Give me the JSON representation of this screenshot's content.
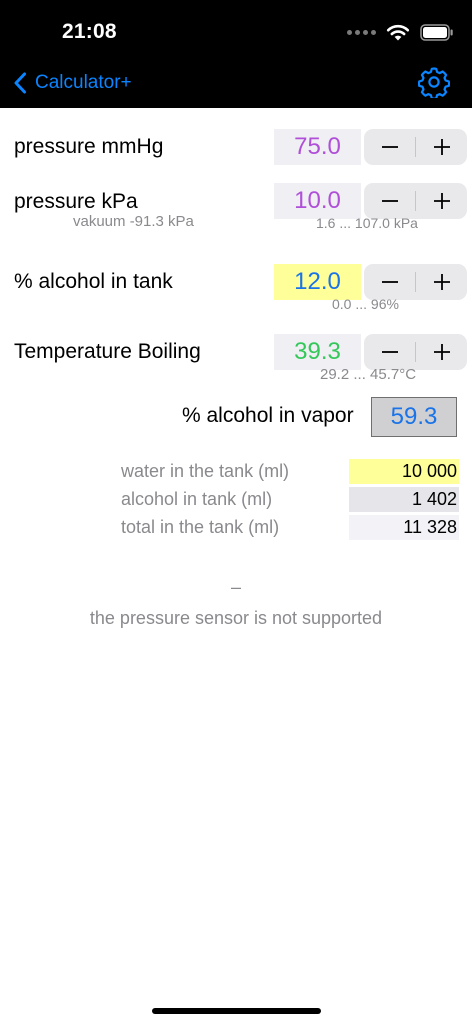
{
  "status": {
    "time": "21:08"
  },
  "nav": {
    "back_label": "Calculator+"
  },
  "rows": [
    {
      "label": "pressure mmHg",
      "value": "75.0"
    },
    {
      "label": "pressure kPa",
      "value": "10.0",
      "note": "vakuum -91.3 kPa",
      "range": "1.6 ... 107.0 kPa"
    },
    {
      "label": "% alcohol in tank",
      "value": "12.0",
      "range": "0.0 ... 96%"
    },
    {
      "label": "Temperature Boiling",
      "value": "39.3",
      "range": "29.2 ... 45.7°C"
    }
  ],
  "vapor": {
    "label": "% alcohol in vapor",
    "value": "59.3"
  },
  "tank": [
    {
      "label": "water in the tank (ml)",
      "value": "10 000"
    },
    {
      "label": "alcohol in tank (ml)",
      "value": "1 402"
    },
    {
      "label": "total in the tank (ml)",
      "value": "11 328"
    }
  ],
  "footer": {
    "dash": "–",
    "message": "the pressure sensor is not supported"
  },
  "colors": {
    "accent": "#0a84ff",
    "pressure_value": "#b04fd8",
    "alcohol_value": "#1a73e8",
    "alcohol_highlight": "#ffff99",
    "temperature_value": "#34c759",
    "water_highlight": "#ffff99",
    "alcohol_tank_bg": "#e5e5ea",
    "total_tank_bg": "#f2f2f7"
  },
  "icons": {
    "back": "chevron-left-icon",
    "settings": "gear-icon",
    "decrement": "minus-icon",
    "increment": "plus-icon"
  }
}
